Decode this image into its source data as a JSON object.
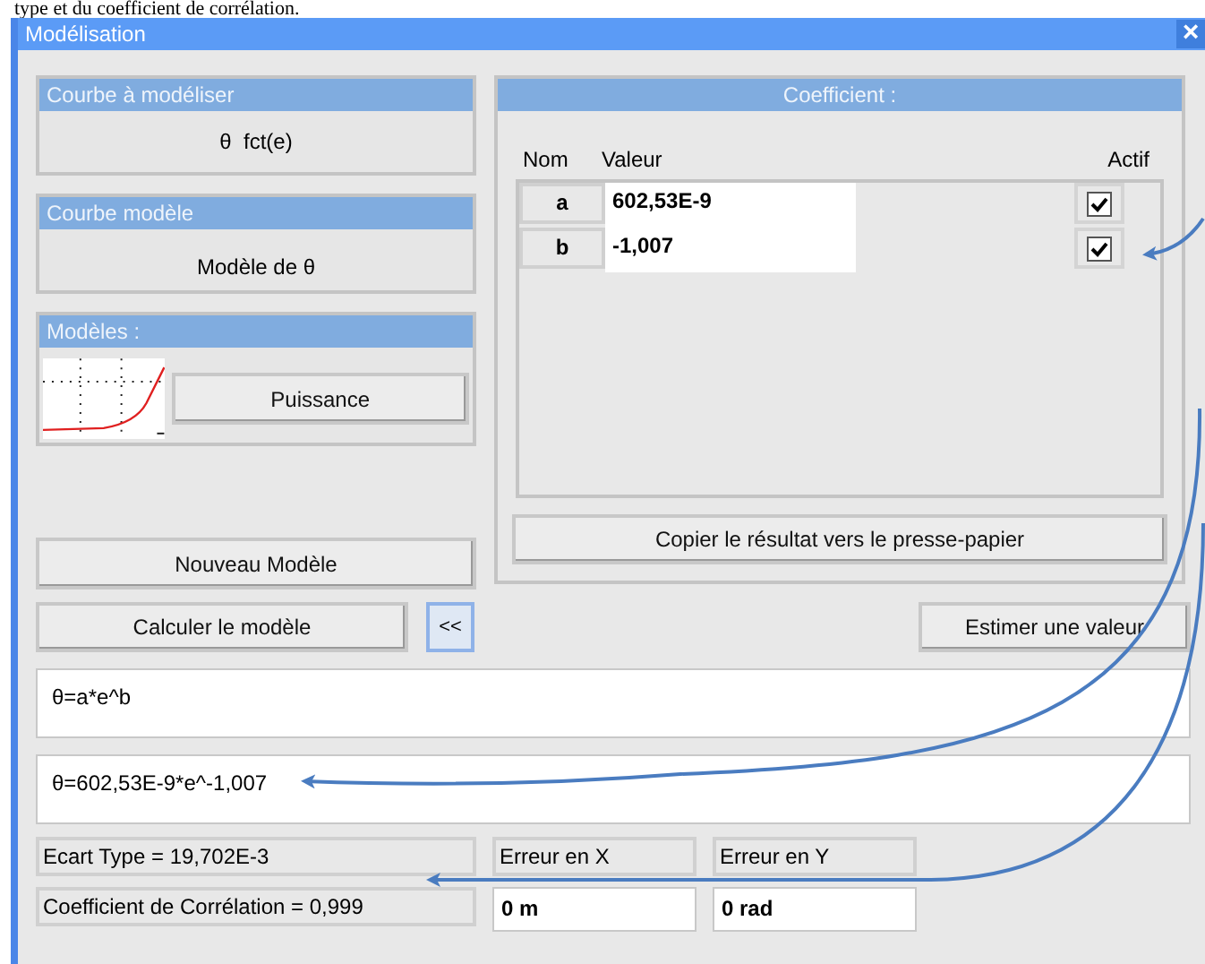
{
  "document_text": "type et du coefficient de corrélation.",
  "window": {
    "title": "Modélisation",
    "close": "×"
  },
  "curve_to_model": {
    "header": "Courbe à modéliser",
    "value": "θ  fct(e)"
  },
  "model_curve": {
    "header": "Courbe modèle",
    "value": "Modèle de θ"
  },
  "models": {
    "header": "Modèles :",
    "button": "Puissance"
  },
  "coefficients": {
    "header": "Coefficient :",
    "columns": [
      "Nom",
      "Valeur",
      "Actif"
    ],
    "rows": [
      {
        "name": "a",
        "value": "602,53E-9",
        "checked": true
      },
      {
        "name": "b",
        "value": "-1,007",
        "checked": true
      }
    ],
    "copy_button": "Copier le résultat vers le presse-papier"
  },
  "buttons": {
    "new_model": "Nouveau Modèle",
    "compute": "Calculer le modèle",
    "collapse": "<<",
    "estimate": "Estimer une valeur"
  },
  "formula": "θ=a*e^b",
  "result": "θ=602,53E-9*e^-1,007",
  "stats": {
    "std_dev": "Ecart Type = 19,702E-3",
    "correlation": "Coefficient de Corrélation = 0,999",
    "error_x_label": "Erreur en X",
    "error_y_label": "Erreur en Y",
    "error_x": "0 m",
    "error_y": "0 rad"
  }
}
